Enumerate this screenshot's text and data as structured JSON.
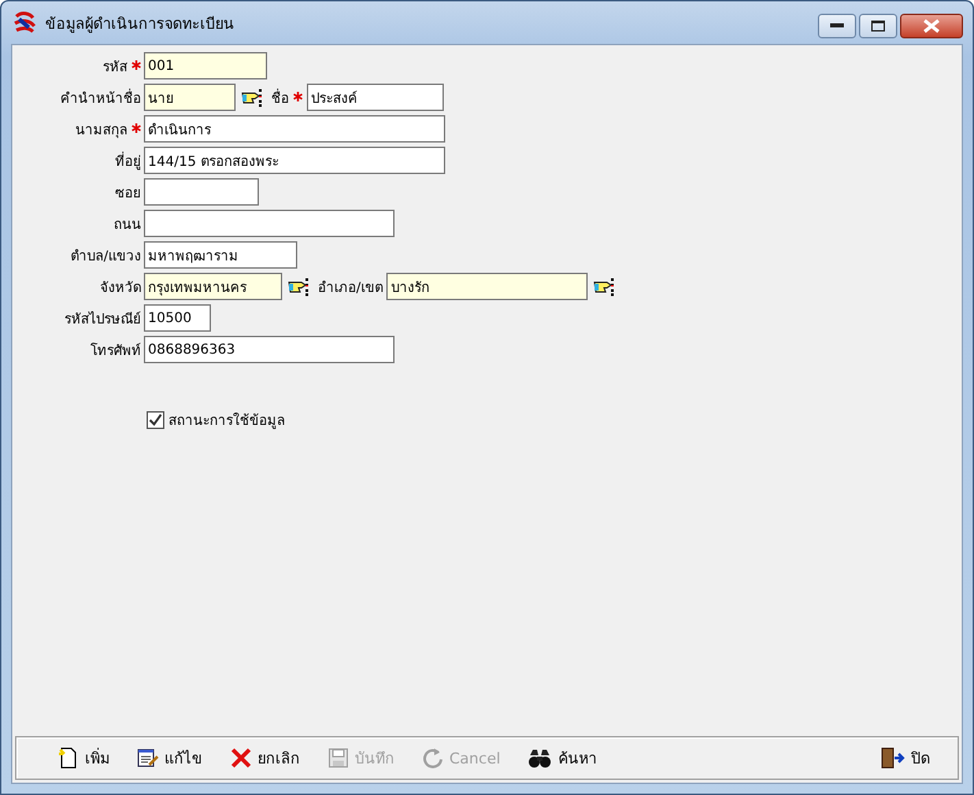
{
  "window": {
    "title": "ข้อมูลผู้ดำเนินการจดทะเบียน"
  },
  "rows": [
    {
      "fields": [
        {
          "label": "รหัส",
          "required": true,
          "value": "001",
          "highlighted": true,
          "lookup": false
        }
      ]
    },
    {
      "fields": [
        {
          "label": "คำนำหน้าชื่อ",
          "required": false,
          "value": "นาย",
          "highlighted": true,
          "lookup": true
        },
        {
          "label": "ชื่อ",
          "required": true,
          "value": "ประสงค์",
          "highlighted": false,
          "lookup": false
        }
      ]
    },
    {
      "fields": [
        {
          "label": "นามสกุล",
          "required": true,
          "value": "ดำเนินการ",
          "highlighted": false,
          "lookup": false
        }
      ]
    },
    {
      "fields": [
        {
          "label": "ที่อยู่",
          "required": false,
          "value": "144/15 ตรอกสองพระ",
          "highlighted": false,
          "lookup": false
        }
      ]
    },
    {
      "fields": [
        {
          "label": "ซอย",
          "required": false,
          "highlighted": false,
          "lookup": false
        }
      ]
    },
    {
      "fields": [
        {
          "label": "ถนน",
          "required": false,
          "highlighted": false,
          "lookup": false
        }
      ]
    },
    {
      "fields": [
        {
          "label": "ตำบล/แขวง",
          "required": false,
          "value": "มหาพฤฒาราม",
          "highlighted": false,
          "lookup": false
        }
      ]
    },
    {
      "fields": [
        {
          "label": "จังหวัด",
          "required": false,
          "value": "กรุงเทพมหานคร",
          "highlighted": true,
          "lookup": true
        },
        {
          "label": "อำเภอ/เขต",
          "required": false,
          "value": "บางรัก",
          "highlighted": true,
          "lookup": true
        }
      ]
    },
    {
      "fields": [
        {
          "label": "รหัสไปรษณีย์",
          "required": false,
          "value": "10500",
          "highlighted": false,
          "lookup": false
        }
      ]
    },
    {
      "fields": [
        {
          "label": "โทรศัพท์",
          "required": false,
          "value": "0868896363",
          "highlighted": false,
          "lookup": false
        }
      ]
    }
  ],
  "status_checkbox": {
    "label": "สถานะการใช้ข้อมูล",
    "checked": true
  },
  "toolbar": [
    {
      "kind": "add",
      "label": "เพิ่ม",
      "disabled": false
    },
    {
      "kind": "edit",
      "label": "แก้ไข",
      "disabled": false
    },
    {
      "kind": "cancel-x",
      "label": "ยกเลิก",
      "disabled": false
    },
    {
      "kind": "save",
      "label": "บันทึก",
      "disabled": true
    },
    {
      "kind": "undo",
      "label": "Cancel",
      "disabled": true
    },
    {
      "kind": "search",
      "label": "ค้นหา",
      "disabled": false
    },
    {
      "kind": "exit",
      "label": "ปิด",
      "disabled": false
    }
  ]
}
